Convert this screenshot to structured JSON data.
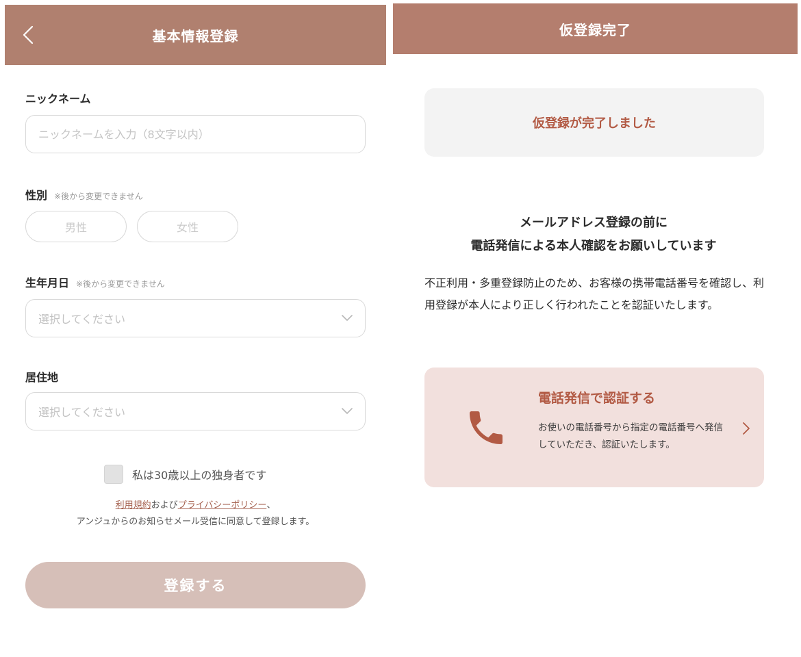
{
  "left_screen": {
    "header": {
      "title": "基本情報登録"
    },
    "nickname": {
      "label": "ニックネーム",
      "placeholder": "ニックネームを入力（8文字以内）"
    },
    "gender": {
      "label": "性別",
      "note": "※後から変更できません",
      "options": [
        "男性",
        "女性"
      ]
    },
    "birthdate": {
      "label": "生年月日",
      "note": "※後から変更できません",
      "placeholder": "選択してください"
    },
    "residence": {
      "label": "居住地",
      "placeholder": "選択してください"
    },
    "agreement": {
      "checkbox_label": "私は30歳以上の独身者です",
      "terms_link": "利用規約",
      "and_text": "および",
      "privacy_link": "プライバシーポリシー",
      "comma": "、",
      "consent_text": "アンジュからのお知らせメール受信に同意して登録します。"
    },
    "submit_label": "登録する"
  },
  "right_screen": {
    "header": {
      "title": "仮登録完了"
    },
    "status_message": "仮登録が完了しました",
    "heading_line1": "メールアドレス登録の前に",
    "heading_line2": "電話発信による本人確認をお願いしています",
    "body": "不正利用・多重登録防止のため、お客様の携帯電話番号を確認し、利用登録が本人により正しく行われたことを認証いたします。",
    "call_card": {
      "title": "電話発信で認証する",
      "description": "お使いの電話番号から指定の電話番号へ発信していただき、認証いたします。"
    }
  },
  "colors": {
    "header_bg": "#b0806f",
    "accent_text": "#b25a44",
    "submit_bg": "#d6bfb8",
    "call_card_bg": "#f2e0dd",
    "status_box_bg": "#f3f3f3"
  },
  "icons": [
    "back-arrow-icon",
    "chevron-down-icon",
    "phone-icon",
    "chevron-right-icon"
  ]
}
